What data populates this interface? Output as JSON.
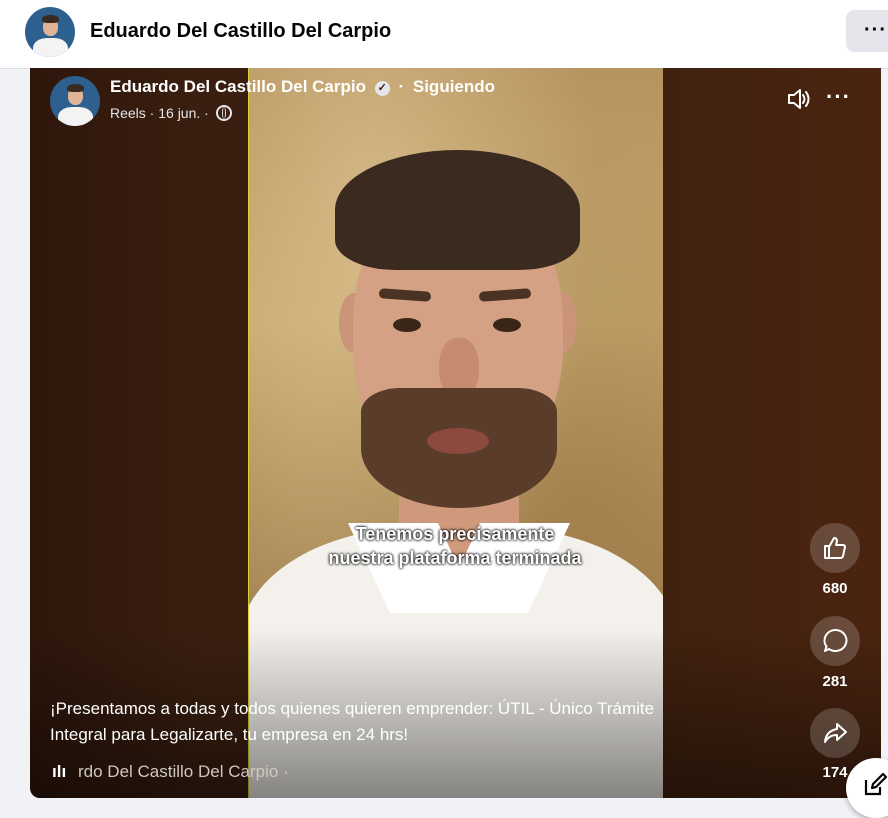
{
  "top_bar": {
    "title": "Eduardo Del Castillo Del Carpio",
    "more_label": "···"
  },
  "post": {
    "author": "Eduardo Del Castillo Del Carpio",
    "follow_status": "Siguiendo",
    "separator": "·",
    "meta": "Reels · 16 jun. ·",
    "more_label": "···",
    "video_caption_line1": "Tenemos precisamente",
    "video_caption_line2": "nuestra plataforma terminada",
    "description_line1": "¡Presentamos a todas y todos quienes quieren emprender: ÚTIL - Único Trámite",
    "description_line2": "Integral para  Legalizarte, tu empresa en 24 hrs!",
    "audio_label": "rdo Del Castillo Del Carpio ·"
  },
  "actions": {
    "likes": "680",
    "comments": "281",
    "shares": "174"
  },
  "icons": {
    "verified": "verified-badge-icon",
    "globe": "globe-icon",
    "speaker": "speaker-icon",
    "like": "thumbs-up-icon",
    "comment": "comment-bubble-icon",
    "share": "share-arrow-icon",
    "audio": "audio-wave-icon",
    "compose": "compose-icon"
  },
  "colors": {
    "card_background": "#3b200f",
    "accent_text": "#ffffff",
    "page_background": "#f0f2f5"
  }
}
